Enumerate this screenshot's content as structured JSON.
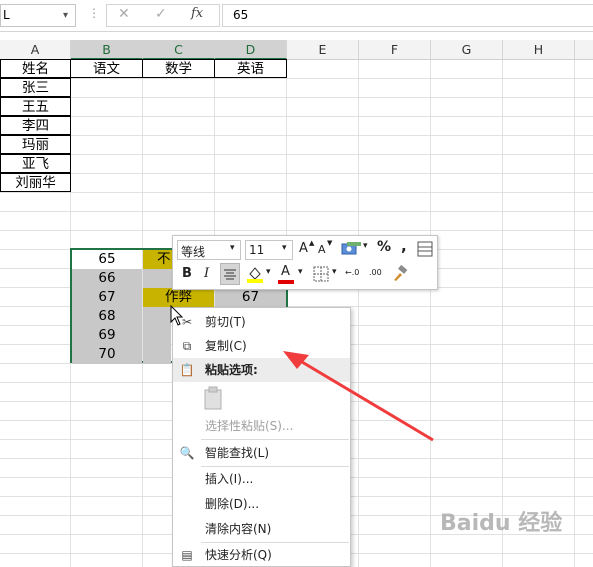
{
  "formula_bar": {
    "name_box": "L",
    "cancel_icon": "✕",
    "enter_icon": "✓",
    "fx_label": "fx",
    "value": "65"
  },
  "columns": [
    "A",
    "B",
    "C",
    "D",
    "E",
    "F",
    "G",
    "H"
  ],
  "header_row": {
    "A": "姓名",
    "B": "语文",
    "C": "数学",
    "D": "英语"
  },
  "names": [
    "张三",
    "王五",
    "李四",
    "玛丽",
    "亚飞",
    "刘丽华"
  ],
  "selection": {
    "b_values": [
      "65",
      "66",
      "67",
      "68",
      "69",
      "70"
    ],
    "c3_text": "作弊",
    "d3_text": "67",
    "c1_text": "不"
  },
  "mini_toolbar": {
    "font": "等线",
    "size": "11",
    "grow_font": "A",
    "shrink_font": "A",
    "percent": "%",
    "comma": ",",
    "bold": "B",
    "italic": "I",
    "font_color_letter": "A",
    "inc_decimal": "←.0",
    "dec_decimal": ".00",
    "accent_font_color": "#e00000",
    "accent_fill_color": "#ffff00"
  },
  "context_menu": {
    "cut": "剪切(T)",
    "copy": "复制(C)",
    "paste_options": "粘贴选项:",
    "paste_special": "选择性粘贴(S)...",
    "smart_lookup": "智能查找(L)",
    "insert": "插入(I)...",
    "delete": "删除(D)...",
    "clear": "清除内容(N)",
    "quick_analysis": "快速分析(Q)"
  },
  "annotation": {
    "arrow_color": "#f03c3c"
  },
  "watermark": "Baidu 经验"
}
